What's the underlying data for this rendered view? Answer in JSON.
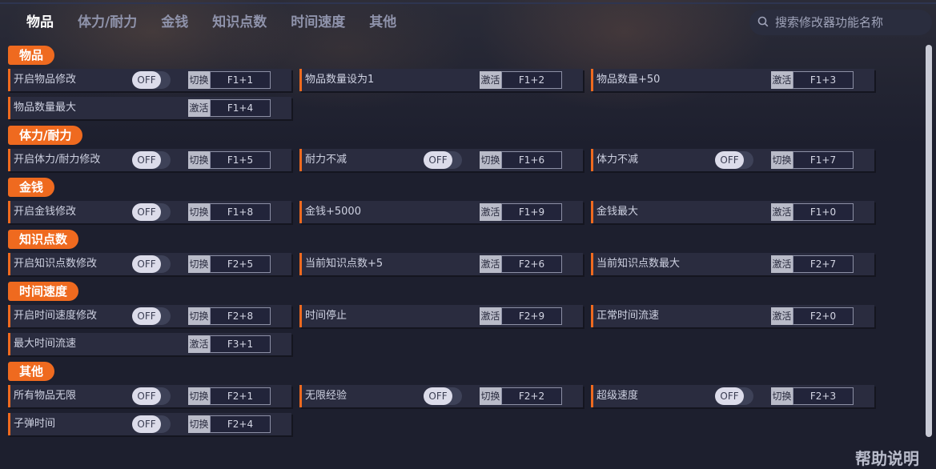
{
  "tabs": [
    "物品",
    "体力/耐力",
    "金钱",
    "知识点数",
    "时间速度",
    "其他"
  ],
  "search": {
    "placeholder": "搜索修改器功能名称"
  },
  "toggle_off_text": "OFF",
  "sections": [
    {
      "title": "物品",
      "rows": [
        {
          "label": "开启物品修改",
          "toggle": true,
          "hotkey_type": "切换",
          "hotkey": "F1+1"
        },
        {
          "label": "物品数量设为1",
          "toggle": false,
          "hotkey_type": "激活",
          "hotkey": "F1+2"
        },
        {
          "label": "物品数量+50",
          "toggle": false,
          "hotkey_type": "激活",
          "hotkey": "F1+3"
        },
        {
          "label": "物品数量最大",
          "toggle": false,
          "hotkey_type": "激活",
          "hotkey": "F1+4"
        }
      ]
    },
    {
      "title": "体力/耐力",
      "rows": [
        {
          "label": "开启体力/耐力修改",
          "toggle": true,
          "hotkey_type": "切换",
          "hotkey": "F1+5"
        },
        {
          "label": "耐力不减",
          "toggle": true,
          "hotkey_type": "切换",
          "hotkey": "F1+6"
        },
        {
          "label": "体力不减",
          "toggle": true,
          "hotkey_type": "切换",
          "hotkey": "F1+7"
        }
      ]
    },
    {
      "title": "金钱",
      "rows": [
        {
          "label": "开启金钱修改",
          "toggle": true,
          "hotkey_type": "切换",
          "hotkey": "F1+8"
        },
        {
          "label": "金钱+5000",
          "toggle": false,
          "hotkey_type": "激活",
          "hotkey": "F1+9"
        },
        {
          "label": "金钱最大",
          "toggle": false,
          "hotkey_type": "激活",
          "hotkey": "F1+0"
        }
      ]
    },
    {
      "title": "知识点数",
      "rows": [
        {
          "label": "开启知识点数修改",
          "toggle": true,
          "hotkey_type": "切换",
          "hotkey": "F2+5"
        },
        {
          "label": "当前知识点数+5",
          "toggle": false,
          "hotkey_type": "激活",
          "hotkey": "F2+6"
        },
        {
          "label": "当前知识点数最大",
          "toggle": false,
          "hotkey_type": "激活",
          "hotkey": "F2+7"
        }
      ]
    },
    {
      "title": "时间速度",
      "rows": [
        {
          "label": "开启时间速度修改",
          "toggle": true,
          "hotkey_type": "切换",
          "hotkey": "F2+8"
        },
        {
          "label": "时间停止",
          "toggle": false,
          "hotkey_type": "激活",
          "hotkey": "F2+9"
        },
        {
          "label": "正常时间流速",
          "toggle": false,
          "hotkey_type": "激活",
          "hotkey": "F2+0"
        },
        {
          "label": "最大时间流速",
          "toggle": false,
          "hotkey_type": "激活",
          "hotkey": "F3+1"
        }
      ]
    },
    {
      "title": "其他",
      "rows": [
        {
          "label": "所有物品无限",
          "toggle": true,
          "hotkey_type": "切换",
          "hotkey": "F2+1"
        },
        {
          "label": "无限经验",
          "toggle": true,
          "hotkey_type": "切换",
          "hotkey": "F2+2"
        },
        {
          "label": "超级速度",
          "toggle": true,
          "hotkey_type": "切换",
          "hotkey": "F2+3"
        },
        {
          "label": "子弹时间",
          "toggle": true,
          "hotkey_type": "切换",
          "hotkey": "F2+4"
        }
      ]
    }
  ],
  "help_label": "帮助说明",
  "colors": {
    "accent": "#ef6a1f",
    "background": "#1d1f2e",
    "row": "#2a2c3f"
  }
}
